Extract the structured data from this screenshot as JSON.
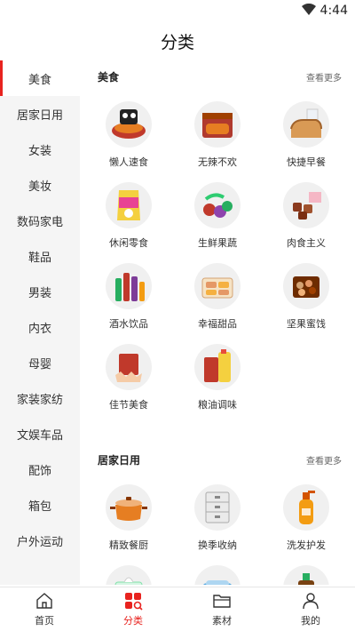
{
  "status": {
    "time": "4:44"
  },
  "header": {
    "title": "分类"
  },
  "sidebar": {
    "items": [
      {
        "label": "美食",
        "active": true
      },
      {
        "label": "居家日用"
      },
      {
        "label": "女装"
      },
      {
        "label": "美妆"
      },
      {
        "label": "数码家电"
      },
      {
        "label": "鞋品"
      },
      {
        "label": "男装"
      },
      {
        "label": "内衣"
      },
      {
        "label": "母婴"
      },
      {
        "label": "家装家纺"
      },
      {
        "label": "文娱车品"
      },
      {
        "label": "配饰"
      },
      {
        "label": "箱包"
      },
      {
        "label": "户外运动"
      }
    ]
  },
  "sections": [
    {
      "title": "美食",
      "more": "查看更多",
      "items": [
        {
          "label": "懒人速食",
          "icon": "instant-noodles-icon"
        },
        {
          "label": "无辣不欢",
          "icon": "spicy-snack-icon"
        },
        {
          "label": "快捷早餐",
          "icon": "bread-icon"
        },
        {
          "label": "休闲零食",
          "icon": "snack-bag-icon"
        },
        {
          "label": "生鲜果蔬",
          "icon": "fruit-icon"
        },
        {
          "label": "肉食主义",
          "icon": "meat-icon"
        },
        {
          "label": "酒水饮品",
          "icon": "drinks-icon"
        },
        {
          "label": "幸福甜品",
          "icon": "dessert-icon"
        },
        {
          "label": "坚果蜜饯",
          "icon": "nuts-icon"
        },
        {
          "label": "佳节美食",
          "icon": "festival-food-icon"
        },
        {
          "label": "粮油调味",
          "icon": "oil-rice-icon"
        }
      ]
    },
    {
      "title": "居家日用",
      "more": "查看更多",
      "items": [
        {
          "label": "精致餐厨",
          "icon": "pot-icon"
        },
        {
          "label": "换季收纳",
          "icon": "storage-box-icon"
        },
        {
          "label": "洗发护发",
          "icon": "shampoo-icon"
        },
        {
          "label": "",
          "icon": "tissue-icon"
        },
        {
          "label": "",
          "icon": "mask-icon"
        },
        {
          "label": "",
          "icon": "disinfectant-icon"
        }
      ]
    }
  ],
  "tabbar": {
    "tabs": [
      {
        "label": "首页",
        "icon": "home-icon"
      },
      {
        "label": "分类",
        "icon": "category-icon",
        "active": true
      },
      {
        "label": "素材",
        "icon": "folder-icon"
      },
      {
        "label": "我的",
        "icon": "user-icon"
      }
    ]
  },
  "colors": {
    "accent": "#e8231f",
    "sidebar_bg": "#f5f5f5"
  }
}
